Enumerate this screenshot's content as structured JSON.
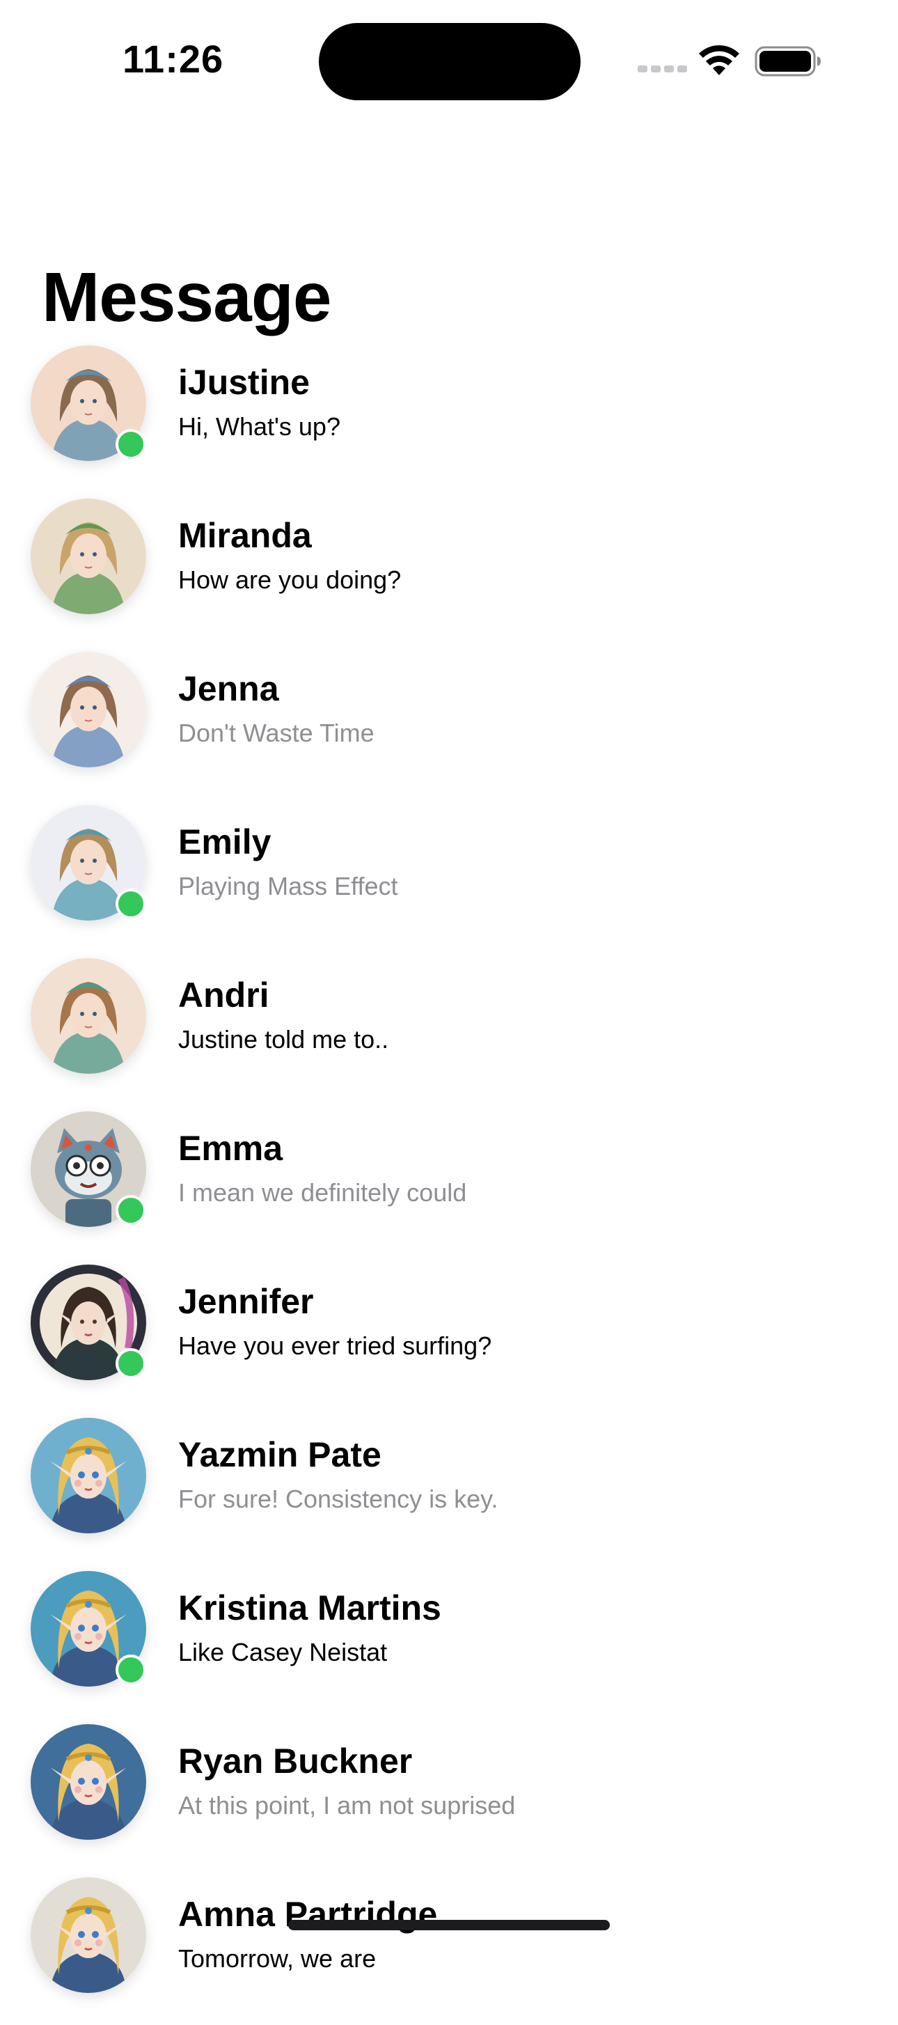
{
  "status_bar": {
    "time": "11:26"
  },
  "page": {
    "title": "Message"
  },
  "conversations": [
    {
      "name": "iJustine",
      "preview": "Hi, What's up?",
      "online": true,
      "read": false,
      "avatar": "elf-watercolor-avatar"
    },
    {
      "name": "Miranda",
      "preview": "How are you doing?",
      "online": false,
      "read": false,
      "avatar": "elf-watercolor-avatar"
    },
    {
      "name": "Jenna",
      "preview": "Don't Waste Time",
      "online": false,
      "read": true,
      "avatar": "elf-watercolor-avatar"
    },
    {
      "name": "Emily",
      "preview": "Playing Mass Effect",
      "online": true,
      "read": true,
      "avatar": "elf-watercolor-avatar"
    },
    {
      "name": "Andri",
      "preview": "Justine told me to..",
      "online": false,
      "read": false,
      "avatar": "elf-watercolor-avatar"
    },
    {
      "name": "Emma",
      "preview": "I mean we definitely could",
      "online": true,
      "read": true,
      "avatar": "robot-cat-avatar"
    },
    {
      "name": "Jennifer",
      "preview": "Have you ever tried surfing?",
      "online": true,
      "read": false,
      "avatar": "elf-dark-hair-avatar"
    },
    {
      "name": "Yazmin Pate",
      "preview": "For sure! Consistency is key.",
      "online": false,
      "read": true,
      "avatar": "elf-blonde-avatar"
    },
    {
      "name": "Kristina Martins",
      "preview": "Like Casey Neistat",
      "online": true,
      "read": false,
      "avatar": "elf-blonde-avatar"
    },
    {
      "name": "Ryan Buckner",
      "preview": "At this point, I am not suprised",
      "online": false,
      "read": true,
      "avatar": "elf-blonde-avatar"
    },
    {
      "name": "Amna Partridge",
      "preview": "Tomorrow, we are",
      "online": false,
      "read": false,
      "avatar": "elf-blonde-avatar"
    }
  ],
  "colors": {
    "online": "#34c759",
    "preview_read": "#8e8e93",
    "text": "#000000",
    "background": "#ffffff"
  }
}
